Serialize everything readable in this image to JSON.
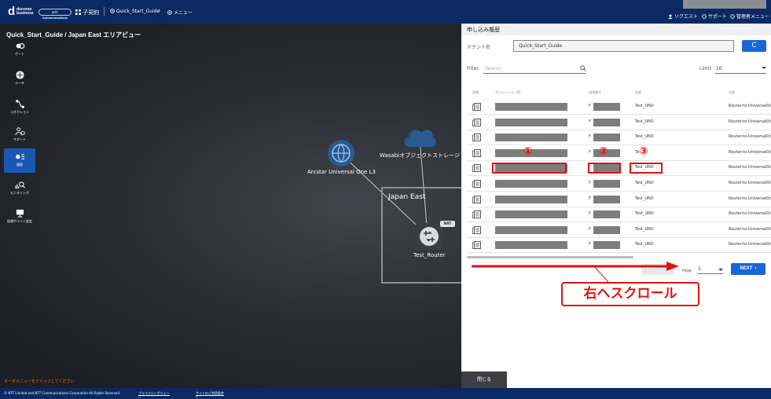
{
  "header": {
    "logo_mark": "d",
    "logo_text": "docomo business",
    "ntt_badge": "NTT Communications",
    "contract": "子契約",
    "breadcrumb": [
      "Quick_Start_Guide",
      "メニュー"
    ],
    "links": [
      "リクエスト",
      "サポート",
      "管理者メニュー"
    ]
  },
  "map": {
    "title": "Quick_Start_Guide / Japan East エリアビュー",
    "sidebar": [
      {
        "label": "ゲート",
        "icon": "gate-icon"
      },
      {
        "label": "ルータ",
        "icon": "router-icon"
      },
      {
        "label": "コネクション",
        "icon": "connection-icon"
      },
      {
        "label": "サポート",
        "icon": "support-icon"
      },
      {
        "label": "履歴",
        "icon": "history-icon",
        "active": true
      },
      {
        "label": "モニタリング",
        "icon": "monitoring-icon"
      },
      {
        "label": "仮想ポイント設定",
        "icon": "monitor-icon"
      }
    ],
    "nodes": {
      "arcstar": "Arcstar Universal One L3",
      "wasabi": "Wasabiオブジェクトストレージ",
      "region": "Japan East",
      "router": "Test_Router",
      "nat": "NAT"
    },
    "hint": "オーダメニューをクリックしてください"
  },
  "panel": {
    "title": "申し込み履歴",
    "tenant_label": "テナント名",
    "tenant_value": "Quick_Start_Guide",
    "refresh": "C",
    "filter_label": "Filter",
    "filter_placeholder": "Search",
    "limit_label": "Limit",
    "limit_value": "10",
    "columns": [
      "詳細",
      "オペレーションID",
      "説明番号",
      "名前",
      "内容"
    ],
    "rows": [
      {
        "prefix": "F",
        "name": "Test_UNO",
        "type": "Router-to-UniversalOne"
      },
      {
        "prefix": "F",
        "name": "Test_UNO",
        "type": "Router-to-UniversalOne"
      },
      {
        "prefix": "F",
        "name": "Test_UNO",
        "type": "Router-to-UniversalOne"
      },
      {
        "prefix": "F",
        "name": "Te",
        "type": "Router-to-UniversalOne"
      },
      {
        "prefix": "F",
        "name": "Test_UNO",
        "type": "Router-to-UniversalOne"
      },
      {
        "prefix": "F",
        "name": "Test_UNO",
        "type": "Router-to-UniversalOne"
      },
      {
        "prefix": "F",
        "name": "Test_UNO",
        "type": "Router-to-UniversalOne"
      },
      {
        "prefix": "F",
        "name": "Test_UNO",
        "type": "Router-to-UniversalOne"
      },
      {
        "prefix": "F",
        "name": "Test_UNO",
        "type": "Router-to-UniversalOne"
      },
      {
        "prefix": "F",
        "name": "Test_UNO",
        "type": "Router-to-UniversalOne"
      }
    ],
    "page_label": "Page",
    "page_value": "1",
    "next": "NEXT"
  },
  "annotations": {
    "markers": [
      "①",
      "②",
      "③"
    ],
    "scroll_note": "右へスクロール",
    "color": "#e3120f"
  },
  "close": "閉じる",
  "footer": {
    "copyright": "© NTT Limited and NTT Communications Corporation All Rights Reserved.",
    "privacy": "プライバシーポリシー",
    "terms": "サイトのご利用条件"
  }
}
